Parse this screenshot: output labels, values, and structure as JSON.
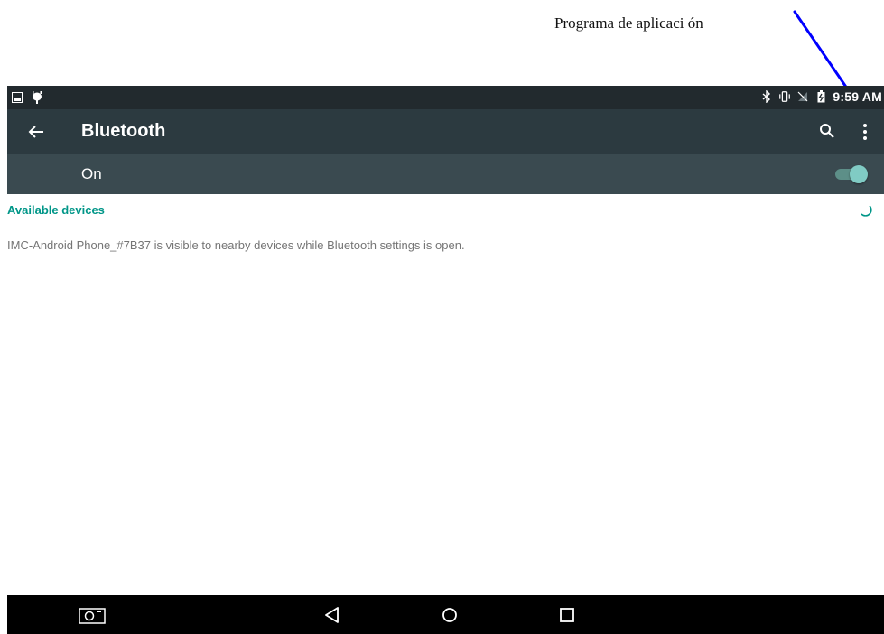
{
  "annotation": {
    "caption": "Programa de aplicaci ón"
  },
  "status_bar": {
    "left_icons": [
      "gallery-icon",
      "android-debug-icon"
    ],
    "right_icons": [
      "bluetooth-icon",
      "vibrate-icon",
      "no-signal-icon",
      "battery-charging-icon"
    ],
    "time": "9:59 AM"
  },
  "toolbar": {
    "title": "Bluetooth",
    "actions": [
      "search-icon",
      "overflow-menu-icon"
    ]
  },
  "switch_bar": {
    "label": "On",
    "checked": true
  },
  "devices": {
    "section_title": "Available devices",
    "scanning": true,
    "visibility_notice": "IMC-Android Phone_#7B37 is visible to nearby devices while Bluetooth settings is open."
  },
  "navigation": {
    "buttons": [
      "screenshot-icon",
      "back-icon",
      "home-icon",
      "recents-icon"
    ]
  },
  "colors": {
    "status_bar": "#222a2e",
    "toolbar": "#2c3a40",
    "switch_bar": "#3a4a50",
    "accent": "#009688",
    "toggle_thumb": "#80cbc4",
    "annotation_arrow": "#0000ff"
  }
}
